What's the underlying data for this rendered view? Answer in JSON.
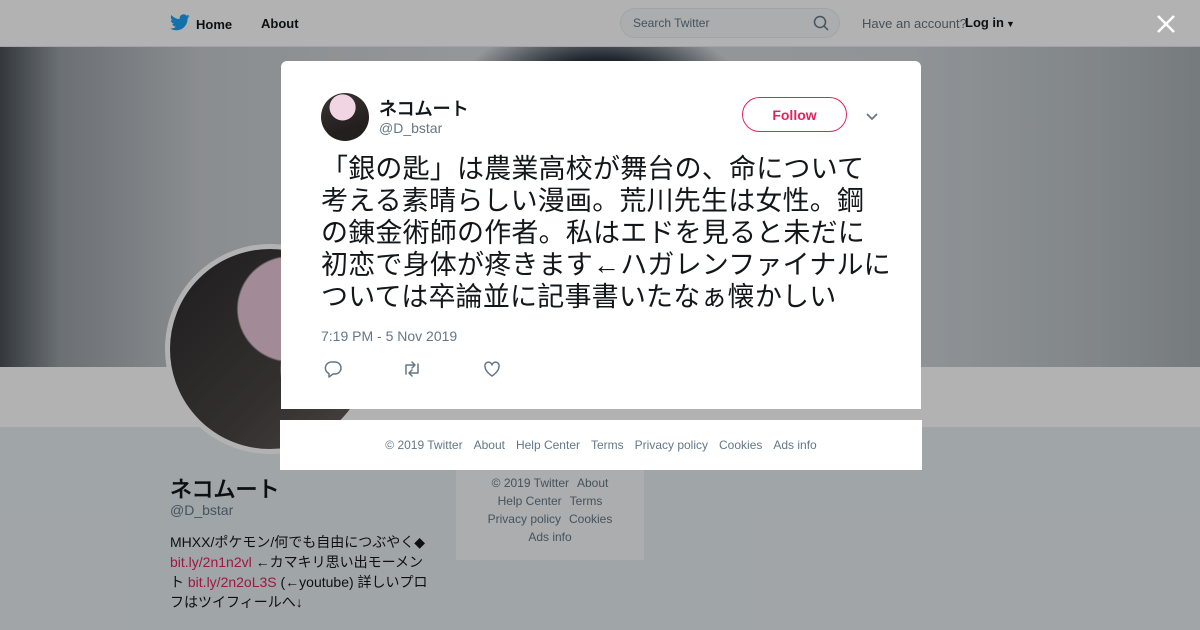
{
  "nav": {
    "home_label": "Home",
    "about_label": "About",
    "search_placeholder": "Search Twitter",
    "have_account": "Have an account?",
    "login_label": "Log in"
  },
  "profile": {
    "name": "ネコムート",
    "handle": "@D_bstar",
    "bio_line1": "MHXX/ポケモン/何でも自由につぶやく◆",
    "bio_link1": "bit.ly/2n1n2vl",
    "bio_mid": " ←カマキリ思い出モーメント ",
    "bio_link2": "bit.ly/2n2oL3S",
    "bio_end": " (←youtube) 詳しいプロフはツイフィールへ↓"
  },
  "side_footer": {
    "links": [
      "© 2019 Twitter",
      "About",
      "Help Center",
      "Terms",
      "Privacy policy",
      "Cookies",
      "Ads info"
    ]
  },
  "tweet": {
    "author_name": "ネコムート",
    "author_handle": "@D_bstar",
    "follow_label": "Follow",
    "text": "「銀の匙」は農業高校が舞台の、命について考える素晴らしい漫画。荒川先生は女性。鋼の錬金術師の作者。私はエドを見ると未だに初恋で身体が疼きます←ハガレンファイナルについては卒論並に記事書いたなぁ懐かしい",
    "timestamp": "7:19 PM - 5 Nov 2019"
  },
  "footer": {
    "links": [
      "© 2019 Twitter",
      "About",
      "Help Center",
      "Terms",
      "Privacy policy",
      "Cookies",
      "Ads info"
    ]
  },
  "colors": {
    "accent": "#e0245e",
    "twitter_blue": "#1da1f2",
    "text_primary": "#14171a",
    "text_secondary": "#657786"
  }
}
